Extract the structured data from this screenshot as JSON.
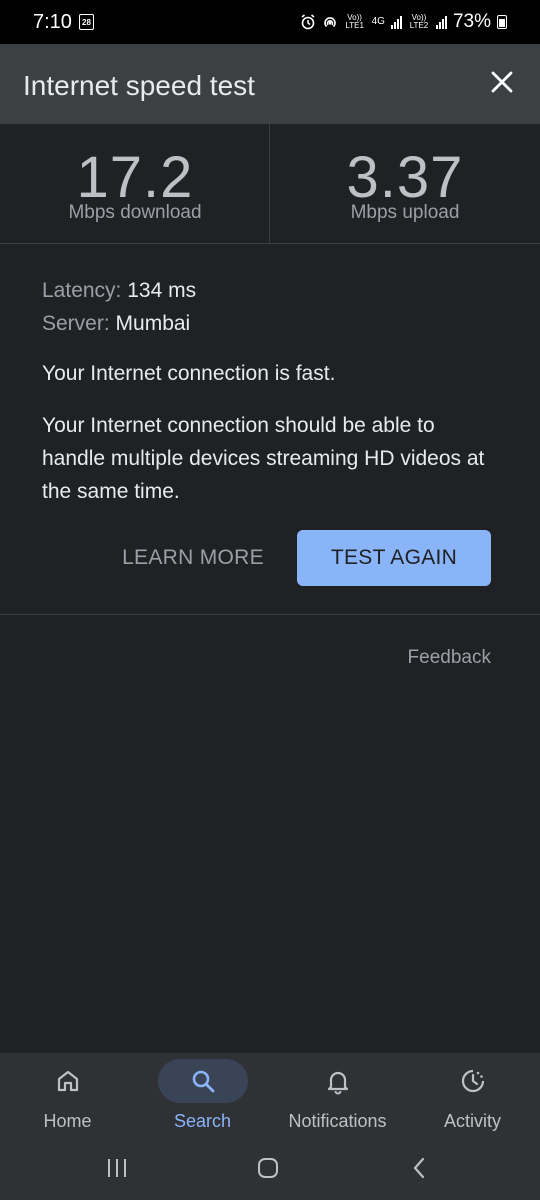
{
  "status_bar": {
    "time": "7:10",
    "calendar_day": "28",
    "volte1": "Vo)) LTE1",
    "network": "4G",
    "volte2": "Vo)) LTE2",
    "battery": "73%"
  },
  "card": {
    "title": "Internet speed test",
    "download": {
      "value": "17.2",
      "unit": "Mbps download"
    },
    "upload": {
      "value": "3.37",
      "unit": "Mbps upload"
    },
    "latency_label": "Latency:",
    "latency_value": "134 ms",
    "server_label": "Server:",
    "server_value": "Mumbai",
    "summary": "Your Internet connection is fast.",
    "description": "Your Internet connection should be able to handle multiple devices streaming HD videos at the same time.",
    "learn_more_label": "LEARN MORE",
    "test_again_label": "TEST AGAIN",
    "feedback_label": "Feedback"
  },
  "bottom_nav": {
    "items": [
      {
        "label": "Home",
        "icon": "home-icon",
        "active": false
      },
      {
        "label": "Search",
        "icon": "search-icon",
        "active": true
      },
      {
        "label": "Notifications",
        "icon": "bell-icon",
        "active": false
      },
      {
        "label": "Activity",
        "icon": "activity-icon",
        "active": false
      }
    ]
  },
  "colors": {
    "accent": "#8ab4f8",
    "card_bg": "#202124",
    "header_bg": "#3c4043",
    "nav_bg": "#303134"
  }
}
